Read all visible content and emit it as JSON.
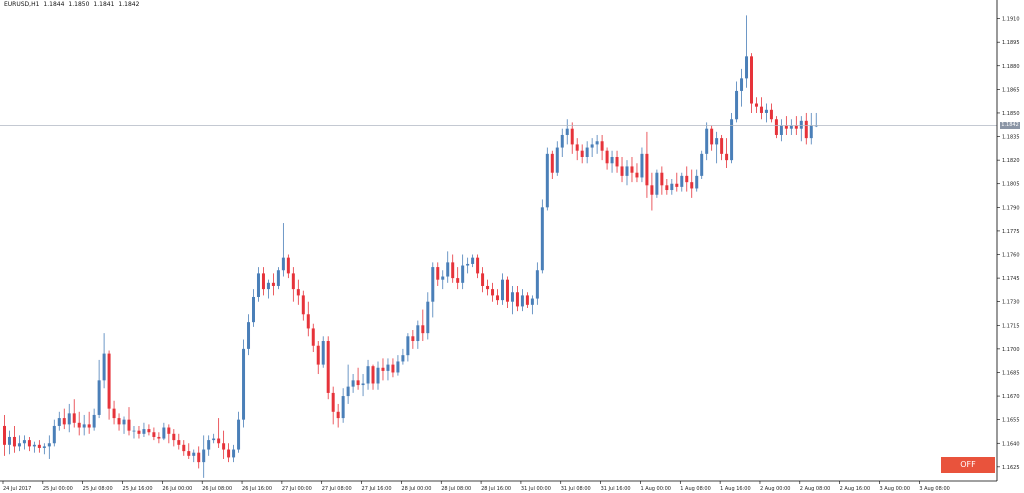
{
  "header": {
    "symbol": "EURUSD,H1",
    "open": "1.1844",
    "high": "1.1850",
    "low": "1.1841",
    "close": "1.1842"
  },
  "price_axis": {
    "labels": [
      "1.1910",
      "1.1895",
      "1.1880",
      "1.1865",
      "1.1850",
      "1.1835",
      "1.1820",
      "1.1805",
      "1.1790",
      "1.1775",
      "1.1760",
      "1.1745",
      "1.1730",
      "1.1715",
      "1.1700",
      "1.1685",
      "1.1670",
      "1.1655",
      "1.1640",
      "1.1625"
    ],
    "current_price_label": "1.1842",
    "current_price": 1.1842
  },
  "time_axis": {
    "labels": [
      "24 Jul 2017",
      "25 Jul 00:00",
      "25 Jul 08:00",
      "25 Jul 16:00",
      "26 Jul 00:00",
      "26 Jul 08:00",
      "26 Jul 16:00",
      "27 Jul 00:00",
      "27 Jul 08:00",
      "27 Jul 16:00",
      "28 Jul 00:00",
      "28 Jul 08:00",
      "28 Jul 16:00",
      "31 Jul 00:00",
      "31 Jul 08:00",
      "31 Jul 16:00",
      "1 Aug 00:00",
      "1 Aug 08:00",
      "1 Aug 16:00",
      "2 Aug 00:00",
      "2 Aug 08:00",
      "2 Aug 16:00",
      "3 Aug 00:00",
      "3 Aug 08:00"
    ]
  },
  "colors": {
    "bull": "#4a7fb8",
    "bear": "#e6333a",
    "grid": "#ffffff",
    "axis": "#000000",
    "price_line": "#b0b7c3",
    "price_tag": "#8a95a5",
    "off_button": "#e9533c"
  },
  "controls": {
    "off_label": "OFF"
  },
  "chart_data": {
    "type": "candlestick",
    "symbol": "EURUSD",
    "timeframe": "H1",
    "ylim": [
      1.1616,
      1.1918
    ],
    "candles": [
      [
        1.1651,
        1.1658,
        1.1632,
        1.1639
      ],
      [
        1.1639,
        1.1648,
        1.1633,
        1.1644
      ],
      [
        1.1644,
        1.1651,
        1.1634,
        1.1638
      ],
      [
        1.1638,
        1.1645,
        1.1635,
        1.164
      ],
      [
        1.164,
        1.1645,
        1.1636,
        1.1642
      ],
      [
        1.1642,
        1.1644,
        1.1635,
        1.1638
      ],
      [
        1.1638,
        1.1641,
        1.1634,
        1.1639
      ],
      [
        1.1639,
        1.1642,
        1.1634,
        1.1637
      ],
      [
        1.1637,
        1.164,
        1.1633,
        1.1638
      ],
      [
        1.1638,
        1.1645,
        1.163,
        1.164
      ],
      [
        1.164,
        1.1655,
        1.1638,
        1.1651
      ],
      [
        1.1651,
        1.166,
        1.1648,
        1.1656
      ],
      [
        1.1656,
        1.1662,
        1.1649,
        1.1652
      ],
      [
        1.1652,
        1.1665,
        1.1647,
        1.1659
      ],
      [
        1.1659,
        1.1668,
        1.165,
        1.1653
      ],
      [
        1.1653,
        1.166,
        1.1645,
        1.165
      ],
      [
        1.165,
        1.1658,
        1.1645,
        1.1652
      ],
      [
        1.1652,
        1.166,
        1.1646,
        1.165
      ],
      [
        1.165,
        1.1662,
        1.1648,
        1.1658
      ],
      [
        1.1658,
        1.1693,
        1.1656,
        1.168
      ],
      [
        1.168,
        1.171,
        1.1675,
        1.1697
      ],
      [
        1.1697,
        1.1699,
        1.1655,
        1.1662
      ],
      [
        1.1662,
        1.1667,
        1.1652,
        1.1656
      ],
      [
        1.1656,
        1.1659,
        1.1648,
        1.1652
      ],
      [
        1.1652,
        1.1657,
        1.1646,
        1.1655
      ],
      [
        1.1655,
        1.1663,
        1.1645,
        1.1648
      ],
      [
        1.1648,
        1.1651,
        1.1643,
        1.1648
      ],
      [
        1.1648,
        1.1651,
        1.1643,
        1.1646
      ],
      [
        1.1646,
        1.1653,
        1.1644,
        1.1649
      ],
      [
        1.1649,
        1.1652,
        1.1645,
        1.1647
      ],
      [
        1.1647,
        1.165,
        1.1642,
        1.1644
      ],
      [
        1.1644,
        1.1647,
        1.164,
        1.1643
      ],
      [
        1.1643,
        1.1653,
        1.1642,
        1.165
      ],
      [
        1.165,
        1.1652,
        1.164,
        1.1646
      ],
      [
        1.1646,
        1.1649,
        1.1638,
        1.1642
      ],
      [
        1.1642,
        1.1646,
        1.1636,
        1.1639
      ],
      [
        1.1639,
        1.1642,
        1.1632,
        1.1635
      ],
      [
        1.1635,
        1.164,
        1.163,
        1.1632
      ],
      [
        1.1632,
        1.1636,
        1.1628,
        1.1634
      ],
      [
        1.1634,
        1.1638,
        1.1624,
        1.1628
      ],
      [
        1.1628,
        1.1645,
        1.1618,
        1.1636
      ],
      [
        1.1636,
        1.1645,
        1.1632,
        1.1642
      ],
      [
        1.1642,
        1.1646,
        1.164,
        1.1643
      ],
      [
        1.1643,
        1.1656,
        1.1637,
        1.164
      ],
      [
        1.164,
        1.1648,
        1.163,
        1.1636
      ],
      [
        1.1636,
        1.164,
        1.1628,
        1.1631
      ],
      [
        1.1631,
        1.1639,
        1.1628,
        1.1636
      ],
      [
        1.1636,
        1.166,
        1.1634,
        1.1655
      ],
      [
        1.1655,
        1.1706,
        1.165,
        1.17
      ],
      [
        1.17,
        1.1722,
        1.1696,
        1.1717
      ],
      [
        1.1717,
        1.1738,
        1.1714,
        1.1733
      ],
      [
        1.1733,
        1.1752,
        1.173,
        1.1748
      ],
      [
        1.1748,
        1.1752,
        1.1734,
        1.1738
      ],
      [
        1.1738,
        1.1744,
        1.1732,
        1.1742
      ],
      [
        1.1742,
        1.1748,
        1.1734,
        1.174
      ],
      [
        1.174,
        1.1752,
        1.1738,
        1.175
      ],
      [
        1.175,
        1.178,
        1.1746,
        1.1758
      ],
      [
        1.1758,
        1.176,
        1.1745,
        1.1748
      ],
      [
        1.1748,
        1.1752,
        1.173,
        1.1738
      ],
      [
        1.1738,
        1.1744,
        1.1728,
        1.1734
      ],
      [
        1.1734,
        1.1737,
        1.1718,
        1.1722
      ],
      [
        1.1722,
        1.173,
        1.1708,
        1.1713
      ],
      [
        1.1713,
        1.1716,
        1.1698,
        1.1702
      ],
      [
        1.1702,
        1.1705,
        1.1684,
        1.169
      ],
      [
        1.169,
        1.1708,
        1.1688,
        1.1705
      ],
      [
        1.1705,
        1.1708,
        1.1668,
        1.1672
      ],
      [
        1.1672,
        1.1676,
        1.1652,
        1.166
      ],
      [
        1.166,
        1.1665,
        1.165,
        1.1656
      ],
      [
        1.1656,
        1.1675,
        1.1653,
        1.167
      ],
      [
        1.167,
        1.169,
        1.1665,
        1.1676
      ],
      [
        1.1676,
        1.1684,
        1.1672,
        1.168
      ],
      [
        1.168,
        1.1688,
        1.1674,
        1.1677
      ],
      [
        1.1677,
        1.1684,
        1.167,
        1.1678
      ],
      [
        1.1678,
        1.1693,
        1.1674,
        1.1689
      ],
      [
        1.1689,
        1.169,
        1.1674,
        1.1678
      ],
      [
        1.1678,
        1.1692,
        1.1674,
        1.1688
      ],
      [
        1.1688,
        1.1694,
        1.168,
        1.1686
      ],
      [
        1.1686,
        1.1694,
        1.168,
        1.169
      ],
      [
        1.169,
        1.1694,
        1.1682,
        1.1685
      ],
      [
        1.1685,
        1.1696,
        1.1683,
        1.1692
      ],
      [
        1.1692,
        1.17,
        1.169,
        1.1696
      ],
      [
        1.1696,
        1.171,
        1.1692,
        1.1708
      ],
      [
        1.1708,
        1.1712,
        1.17,
        1.1705
      ],
      [
        1.1705,
        1.1718,
        1.17,
        1.1715
      ],
      [
        1.1715,
        1.1725,
        1.1705,
        1.171
      ],
      [
        1.171,
        1.1736,
        1.1706,
        1.173
      ],
      [
        1.173,
        1.1755,
        1.172,
        1.1752
      ],
      [
        1.1752,
        1.1755,
        1.174,
        1.1744
      ],
      [
        1.1744,
        1.175,
        1.1738,
        1.1746
      ],
      [
        1.1746,
        1.1762,
        1.1742,
        1.1755
      ],
      [
        1.1755,
        1.176,
        1.1742,
        1.1745
      ],
      [
        1.1745,
        1.1752,
        1.1738,
        1.1742
      ],
      [
        1.1742,
        1.176,
        1.1738,
        1.1753
      ],
      [
        1.1753,
        1.1758,
        1.1748,
        1.1754
      ],
      [
        1.1754,
        1.176,
        1.1752,
        1.1758
      ],
      [
        1.1758,
        1.176,
        1.1745,
        1.1748
      ],
      [
        1.1748,
        1.1752,
        1.1736,
        1.174
      ],
      [
        1.174,
        1.1744,
        1.1734,
        1.1738
      ],
      [
        1.1738,
        1.1742,
        1.173,
        1.1734
      ],
      [
        1.1734,
        1.1738,
        1.1728,
        1.1731
      ],
      [
        1.1731,
        1.1748,
        1.1728,
        1.1744
      ],
      [
        1.1744,
        1.1746,
        1.1726,
        1.173
      ],
      [
        1.173,
        1.174,
        1.1722,
        1.1736
      ],
      [
        1.1736,
        1.174,
        1.1724,
        1.1727
      ],
      [
        1.1727,
        1.1738,
        1.1724,
        1.1734
      ],
      [
        1.1734,
        1.1736,
        1.1726,
        1.1728
      ],
      [
        1.1728,
        1.1734,
        1.1722,
        1.1732
      ],
      [
        1.1732,
        1.1755,
        1.1728,
        1.175
      ],
      [
        1.175,
        1.1795,
        1.1748,
        1.179
      ],
      [
        1.179,
        1.1828,
        1.1788,
        1.1824
      ],
      [
        1.1824,
        1.1826,
        1.1808,
        1.1812
      ],
      [
        1.1812,
        1.1832,
        1.181,
        1.1828
      ],
      [
        1.1828,
        1.184,
        1.1822,
        1.1836
      ],
      [
        1.1836,
        1.1846,
        1.183,
        1.184
      ],
      [
        1.184,
        1.1844,
        1.1824,
        1.183
      ],
      [
        1.183,
        1.1834,
        1.182,
        1.1826
      ],
      [
        1.1826,
        1.183,
        1.1818,
        1.1822
      ],
      [
        1.1822,
        1.1832,
        1.1818,
        1.1828
      ],
      [
        1.1828,
        1.1834,
        1.1822,
        1.183
      ],
      [
        1.183,
        1.1836,
        1.1824,
        1.1832
      ],
      [
        1.1832,
        1.1836,
        1.182,
        1.1826
      ],
      [
        1.1826,
        1.1828,
        1.1814,
        1.1818
      ],
      [
        1.1818,
        1.1826,
        1.1812,
        1.1822
      ],
      [
        1.1822,
        1.1826,
        1.1812,
        1.1816
      ],
      [
        1.1816,
        1.1822,
        1.1806,
        1.181
      ],
      [
        1.181,
        1.182,
        1.1804,
        1.1816
      ],
      [
        1.1816,
        1.1822,
        1.1806,
        1.1812
      ],
      [
        1.1812,
        1.1818,
        1.1806,
        1.1809
      ],
      [
        1.1809,
        1.1828,
        1.1806,
        1.1824
      ],
      [
        1.1824,
        1.1838,
        1.1796,
        1.1804
      ],
      [
        1.1804,
        1.1812,
        1.1788,
        1.1798
      ],
      [
        1.1798,
        1.1814,
        1.1796,
        1.1812
      ],
      [
        1.1812,
        1.1816,
        1.1798,
        1.1804
      ],
      [
        1.1804,
        1.1808,
        1.1798,
        1.1801
      ],
      [
        1.1801,
        1.1808,
        1.1798,
        1.1805
      ],
      [
        1.1805,
        1.1812,
        1.18,
        1.1803
      ],
      [
        1.1803,
        1.1812,
        1.18,
        1.181
      ],
      [
        1.181,
        1.1816,
        1.18,
        1.1806
      ],
      [
        1.1806,
        1.1814,
        1.1796,
        1.1802
      ],
      [
        1.1802,
        1.1814,
        1.18,
        1.181
      ],
      [
        1.181,
        1.1826,
        1.1808,
        1.1824
      ],
      [
        1.1824,
        1.1844,
        1.182,
        1.184
      ],
      [
        1.184,
        1.1842,
        1.1826,
        1.183
      ],
      [
        1.183,
        1.1838,
        1.1818,
        1.1834
      ],
      [
        1.1834,
        1.1836,
        1.182,
        1.1824
      ],
      [
        1.1824,
        1.1834,
        1.1815,
        1.182
      ],
      [
        1.182,
        1.185,
        1.1818,
        1.1846
      ],
      [
        1.1846,
        1.187,
        1.1844,
        1.1864
      ],
      [
        1.1864,
        1.1878,
        1.1854,
        1.1872
      ],
      [
        1.1872,
        1.1912,
        1.1866,
        1.1886
      ],
      [
        1.1886,
        1.1888,
        1.185,
        1.1856
      ],
      [
        1.1856,
        1.186,
        1.185,
        1.1854
      ],
      [
        1.1854,
        1.186,
        1.1846,
        1.185
      ],
      [
        1.185,
        1.1856,
        1.1844,
        1.1852
      ],
      [
        1.1852,
        1.1856,
        1.1844,
        1.1846
      ],
      [
        1.1846,
        1.1848,
        1.1834,
        1.1836
      ],
      [
        1.1836,
        1.1846,
        1.1832,
        1.1842
      ],
      [
        1.1842,
        1.1848,
        1.1836,
        1.184
      ],
      [
        1.184,
        1.1846,
        1.1836,
        1.1842
      ],
      [
        1.1842,
        1.1848,
        1.1836,
        1.184
      ],
      [
        1.184,
        1.1848,
        1.1832,
        1.1845
      ],
      [
        1.1845,
        1.185,
        1.183,
        1.1834
      ],
      [
        1.1834,
        1.185,
        1.183,
        1.1842
      ],
      [
        1.1842,
        1.185,
        1.1841,
        1.1842
      ]
    ]
  }
}
